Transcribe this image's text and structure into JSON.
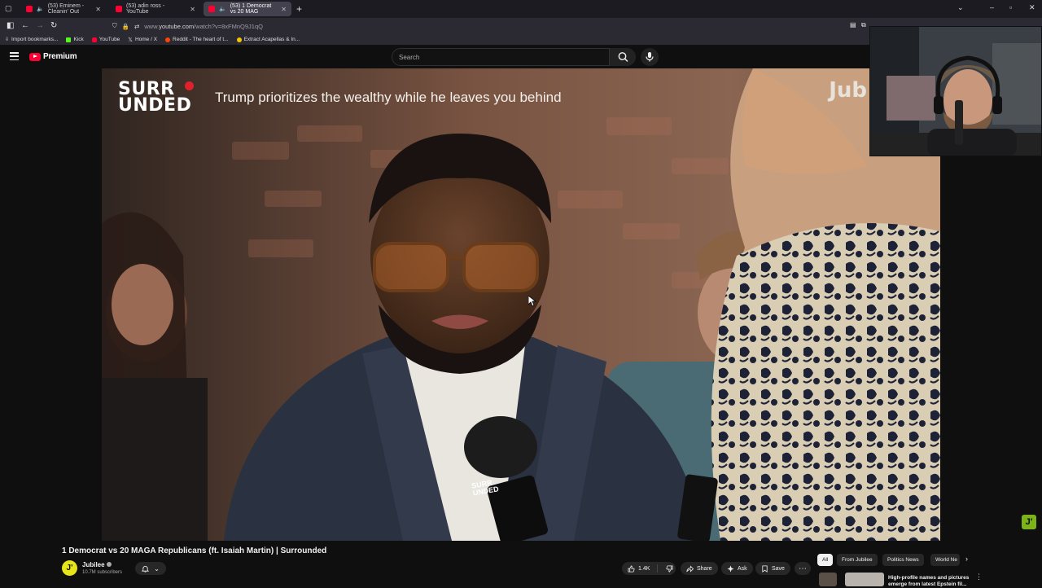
{
  "browser": {
    "tabs": [
      {
        "title": "(53) Eminem - Cleanin' Out",
        "active": false
      },
      {
        "title": "(53) adin ross - YouTube",
        "active": false
      },
      {
        "title": "(53) 1 Democrat vs 20 MAG",
        "active": true
      }
    ],
    "url_prefix": "www.",
    "url_domain": "youtube.com",
    "url_path": "/watch?v=8xFMnQ9J1qQ",
    "bookmarks": [
      {
        "label": "Import bookmarks...",
        "icon": "import-icon"
      },
      {
        "label": "Kick",
        "icon": "kick-icon",
        "color": "#53fc18"
      },
      {
        "label": "YouTube",
        "icon": "youtube-icon",
        "color": "#ff0033"
      },
      {
        "label": "Home / X",
        "icon": "x-icon"
      },
      {
        "label": "Reddit - The heart of t...",
        "icon": "reddit-icon",
        "color": "#ff4500"
      },
      {
        "label": "Extract Acapellas & In...",
        "icon": "extract-icon",
        "color": "#f5c400"
      }
    ]
  },
  "youtube": {
    "logo_text": "Premium",
    "search_placeholder": "Search",
    "video": {
      "overlay_brand_line1": "SURR",
      "overlay_brand_line2": "UNDED",
      "overlay_headline": "Trump prioritizes the wealthy while he leaves you behind",
      "overlay_watermark": "Jub",
      "mic_label_top": "SURR",
      "mic_label_bottom": "UNDED"
    },
    "title": "1 Democrat vs 20 MAGA Republicans (ft. Isaiah Martin) | Surrounded",
    "channel": {
      "name": "Jubilee",
      "subscribers": "10.7M subscribers",
      "avatar_letter": "J'"
    },
    "actions": {
      "like_count": "1.4K",
      "share": "Share",
      "ask": "Ask",
      "save": "Save"
    },
    "chips": [
      {
        "label": "All",
        "active": true
      },
      {
        "label": "From Jubilee",
        "active": false
      },
      {
        "label": "Politics News",
        "active": false
      },
      {
        "label": "World Ne",
        "active": false
      }
    ],
    "recommendation": {
      "title": "High-profile names and pictures emerge from latest Epstein fil..."
    },
    "corner_badge": "J'"
  },
  "colors": {
    "youtube_red": "#ff0033",
    "jubilee_yellow": "#e7e519",
    "jubilee_green": "#7bb318"
  }
}
